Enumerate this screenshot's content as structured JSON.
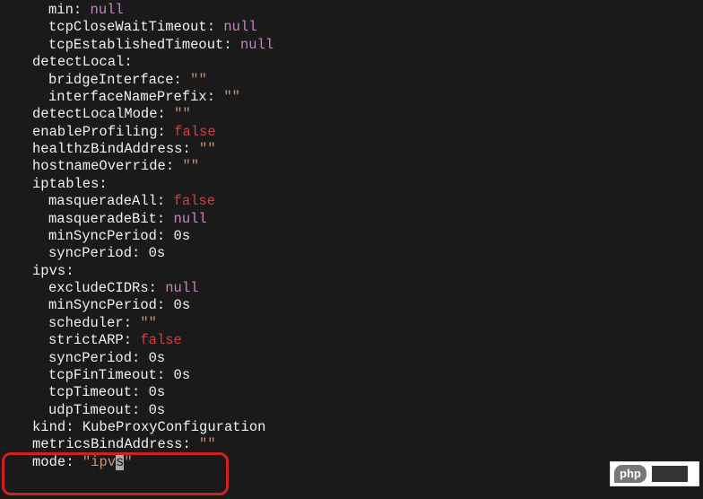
{
  "lines": [
    {
      "indent": "ind2",
      "key": "min",
      "sep": ": ",
      "valClass": "null",
      "val": "null"
    },
    {
      "indent": "ind2",
      "key": "tcpCloseWaitTimeout",
      "sep": ": ",
      "valClass": "null",
      "val": "null"
    },
    {
      "indent": "ind2",
      "key": "tcpEstablishedTimeout",
      "sep": ": ",
      "valClass": "null",
      "val": "null"
    },
    {
      "indent": "ind1",
      "key": "detectLocal",
      "sep": ":",
      "valClass": "",
      "val": ""
    },
    {
      "indent": "ind2",
      "key": "bridgeInterface",
      "sep": ": ",
      "valClass": "str",
      "val": "\"\""
    },
    {
      "indent": "ind2",
      "key": "interfaceNamePrefix",
      "sep": ": ",
      "valClass": "str",
      "val": "\"\""
    },
    {
      "indent": "ind1",
      "key": "detectLocalMode",
      "sep": ": ",
      "valClass": "str",
      "val": "\"\""
    },
    {
      "indent": "ind1",
      "key": "enableProfiling",
      "sep": ": ",
      "valClass": "false",
      "val": "false"
    },
    {
      "indent": "ind1",
      "key": "healthzBindAddress",
      "sep": ": ",
      "valClass": "str",
      "val": "\"\""
    },
    {
      "indent": "ind1",
      "key": "hostnameOverride",
      "sep": ": ",
      "valClass": "str",
      "val": "\"\""
    },
    {
      "indent": "ind1",
      "key": "iptables",
      "sep": ":",
      "valClass": "",
      "val": ""
    },
    {
      "indent": "ind2",
      "key": "masqueradeAll",
      "sep": ": ",
      "valClass": "false",
      "val": "false"
    },
    {
      "indent": "ind2",
      "key": "masqueradeBit",
      "sep": ": ",
      "valClass": "null",
      "val": "null"
    },
    {
      "indent": "ind2",
      "key": "minSyncPeriod",
      "sep": ": ",
      "valClass": "white",
      "val": "0s"
    },
    {
      "indent": "ind2",
      "key": "syncPeriod",
      "sep": ": ",
      "valClass": "white",
      "val": "0s"
    },
    {
      "indent": "ind1",
      "key": "ipvs",
      "sep": ":",
      "valClass": "",
      "val": ""
    },
    {
      "indent": "ind2",
      "key": "excludeCIDRs",
      "sep": ": ",
      "valClass": "null",
      "val": "null"
    },
    {
      "indent": "ind2",
      "key": "minSyncPeriod",
      "sep": ": ",
      "valClass": "white",
      "val": "0s"
    },
    {
      "indent": "ind2",
      "key": "scheduler",
      "sep": ": ",
      "valClass": "str",
      "val": "\"\""
    },
    {
      "indent": "ind2",
      "key": "strictARP",
      "sep": ": ",
      "valClass": "false",
      "val": "false"
    },
    {
      "indent": "ind2",
      "key": "syncPeriod",
      "sep": ": ",
      "valClass": "white",
      "val": "0s"
    },
    {
      "indent": "ind2",
      "key": "tcpFinTimeout",
      "sep": ": ",
      "valClass": "white",
      "val": "0s"
    },
    {
      "indent": "ind2",
      "key": "tcpTimeout",
      "sep": ": ",
      "valClass": "white",
      "val": "0s"
    },
    {
      "indent": "ind2",
      "key": "udpTimeout",
      "sep": ": ",
      "valClass": "white",
      "val": "0s"
    },
    {
      "indent": "ind1",
      "key": "kind",
      "sep": ": ",
      "valClass": "white",
      "val": "KubeProxyConfiguration"
    },
    {
      "indent": "ind1",
      "key": "metricsBindAddress",
      "sep": ": ",
      "valClass": "str",
      "val": "\"\""
    }
  ],
  "modeLine": {
    "key": "mode",
    "sep": ": ",
    "q1": "\"",
    "pre": "ipv",
    "cur": "s",
    "q2": "\""
  },
  "watermark": {
    "php": "php"
  }
}
